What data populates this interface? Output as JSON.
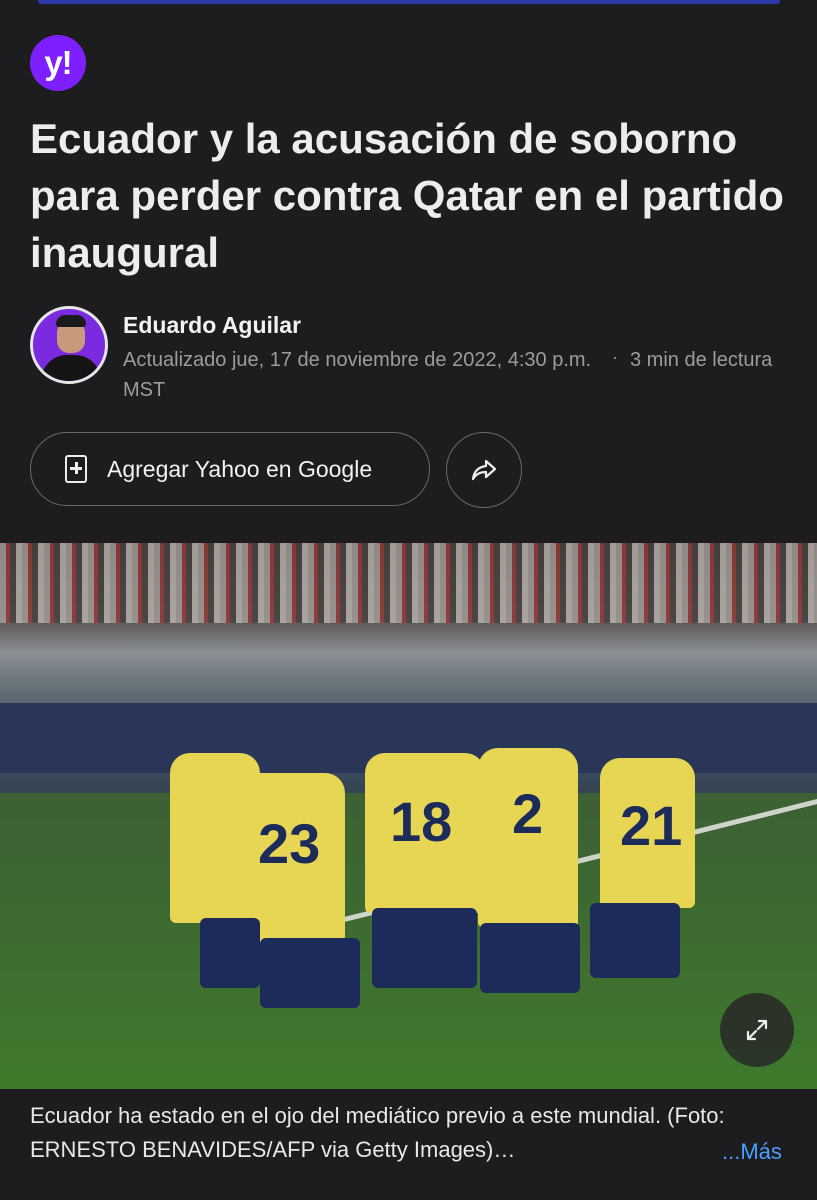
{
  "brand": {
    "logo_text": "y!",
    "color": "#7e1fff"
  },
  "article": {
    "headline": "Ecuador y la acusación de soborno para perder contra Qatar en el partido inaugural",
    "author": "Eduardo Aguilar",
    "updated": "Actualizado jue, 17 de noviembre de 2022, 4:30 p.m. MST",
    "separator": "·",
    "read_time": "3 min de lectura"
  },
  "actions": {
    "google_button_label": "Agregar Yahoo en Google",
    "google_icon": "document-plus-icon",
    "share_icon": "share-arrow-icon"
  },
  "photo": {
    "jersey_numbers": [
      "23",
      "18",
      "2",
      "21"
    ],
    "expand_icon": "expand-arrows-icon"
  },
  "caption": {
    "text": "Ecuador ha estado en el ojo del mediático previo a este mundial. (Foto: ERNESTO BENAVIDES/AFP via Getty Images)…",
    "more_label": "...Más",
    "more_color": "#4a9eff"
  }
}
